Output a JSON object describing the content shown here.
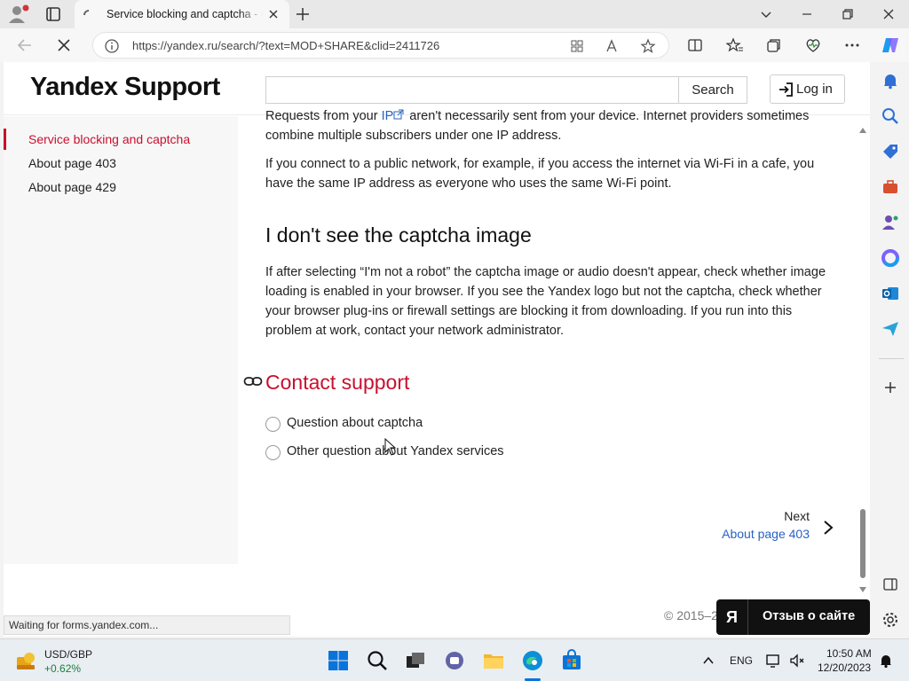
{
  "browser": {
    "tab_title": "Service blocking and captcha - Chrome",
    "url": "https://yandex.ru/search/?text=MOD+SHARE&clid=2411726"
  },
  "site": {
    "logo": "Yandex Support",
    "search_label": "Search",
    "search_value": "",
    "login_label": "Log in"
  },
  "sidebar_nav": {
    "items": [
      {
        "label": "Service blocking and captcha",
        "active": true
      },
      {
        "label": "About page 403",
        "active": false
      },
      {
        "label": "About page 429",
        "active": false
      }
    ]
  },
  "article": {
    "partial_para_a": "Requests from your ",
    "partial_para_link": "IP",
    "partial_para_b": " aren't necessarily sent from your device. Internet providers sometimes combine multiple subscribers under one IP address.",
    "para_public": "If you connect to a public network, for example, if you access the internet via Wi-Fi in a cafe, you have the same IP address as everyone who uses the same Wi-Fi point.",
    "heading_captcha": "I don't see the captcha image",
    "para_captcha": "If after selecting “I'm not a robot” the captcha image or audio doesn't appear, check whether image loading is enabled in your browser. If you see the Yandex logo but not the captcha, check whether your browser plug-ins or firewall settings are blocking it from downloading. If you run into this problem at work, contact your network administrator.",
    "heading_contact": "Contact support",
    "options": [
      {
        "label": "Question about captcha"
      },
      {
        "label": "Other question about Yandex services"
      }
    ],
    "next_label": "Next",
    "next_link": "About page 403"
  },
  "footer": {
    "copyright": "© 2015–2",
    "feedback_logo": "Я",
    "feedback_label": "Отзыв о сайте"
  },
  "status_bar": "Waiting for forms.yandex.com...",
  "taskbar": {
    "ticker_symbol": "USD/GBP",
    "ticker_change": "+0.62%",
    "language": "ENG",
    "time": "10:50 AM",
    "date": "12/20/2023"
  },
  "colors": {
    "accent_red": "#c8102e",
    "link_blue": "#2962c4"
  }
}
